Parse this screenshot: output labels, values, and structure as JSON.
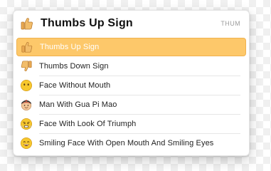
{
  "header": {
    "title": "Thumbs Up Sign",
    "tag": "THUM",
    "icon": "thumbs-up-icon"
  },
  "results": [
    {
      "label": "Thumbs Up Sign",
      "icon": "thumbs-up-icon",
      "selected": true
    },
    {
      "label": "Thumbs Down Sign",
      "icon": "thumbs-down-icon",
      "selected": false
    },
    {
      "label": "Face Without Mouth",
      "icon": "face-without-mouth-icon",
      "selected": false
    },
    {
      "label": "Man With Gua Pi Mao",
      "icon": "man-with-gua-pi-mao-icon",
      "selected": false
    },
    {
      "label": "Face With Look Of Triumph",
      "icon": "face-with-look-of-triumph-icon",
      "selected": false
    },
    {
      "label": "Smiling Face With Open Mouth And Smiling Eyes",
      "icon": "smiling-face-open-mouth-smiling-eyes-icon",
      "selected": false
    }
  ],
  "colors": {
    "selected_bg": "#fdc86a",
    "emoji_yellow": "#f7c82e"
  }
}
